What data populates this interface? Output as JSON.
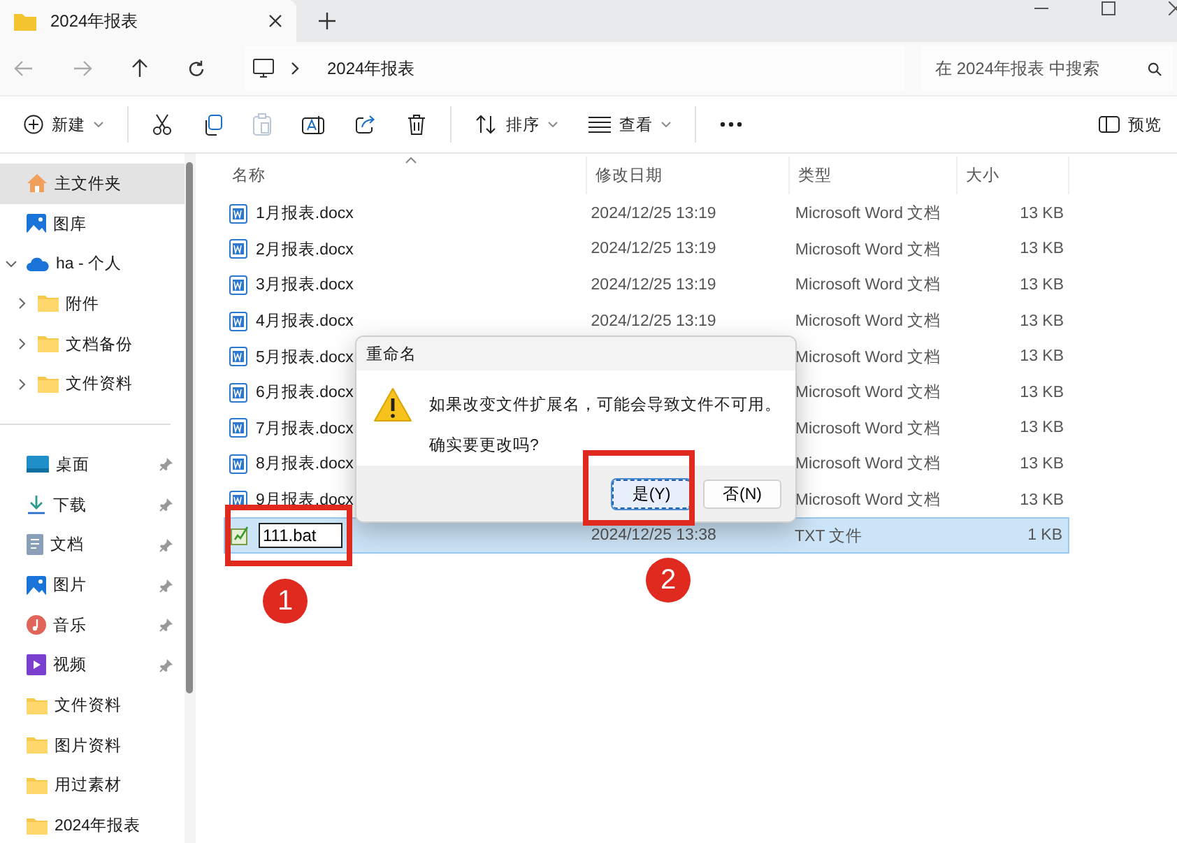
{
  "window": {
    "tab_title": "2024年报表"
  },
  "address": {
    "path": "2024年报表",
    "search_placeholder": "在 2024年报表 中搜索"
  },
  "toolbar": [
    {
      "kind": "new",
      "label": "新建",
      "disabled": false
    },
    {
      "kind": "cut",
      "disabled": false
    },
    {
      "kind": "copy",
      "disabled": false
    },
    {
      "kind": "paste",
      "disabled": true
    },
    {
      "kind": "rename",
      "disabled": false
    },
    {
      "kind": "share",
      "disabled": false
    },
    {
      "kind": "delete",
      "disabled": false
    },
    {
      "kind": "sort",
      "label": "排序",
      "disabled": false
    },
    {
      "kind": "view",
      "label": "查看",
      "disabled": false
    },
    {
      "kind": "more",
      "disabled": false
    }
  ],
  "preview": "预览",
  "sidebar": {
    "groups": [
      [
        {
          "label": "主文件夹",
          "kind": "home",
          "selected": true
        },
        {
          "label": "图库",
          "kind": "gallery",
          "selected": false
        },
        {
          "label": "ha - 个人",
          "kind": "cloud",
          "selected": false,
          "expanded": true,
          "children": [
            {
              "label": "附件",
              "kind": "folder",
              "selected": false,
              "expanded": false
            },
            {
              "label": "文档备份",
              "kind": "folder",
              "selected": false,
              "expanded": false
            },
            {
              "label": "文件资料",
              "kind": "folder",
              "selected": false,
              "expanded": false
            }
          ]
        }
      ],
      [
        {
          "label": "桌面",
          "kind": "desktop",
          "selected": false,
          "pinned": true
        },
        {
          "label": "下载",
          "kind": "download",
          "selected": false,
          "pinned": true
        },
        {
          "label": "文档",
          "kind": "document",
          "selected": false,
          "pinned": true
        },
        {
          "label": "图片",
          "kind": "gallery",
          "selected": false,
          "pinned": true
        },
        {
          "label": "音乐",
          "kind": "music",
          "selected": false,
          "pinned": true
        },
        {
          "label": "视频",
          "kind": "video",
          "selected": false,
          "pinned": true
        },
        {
          "label": "文件资料",
          "kind": "folder",
          "selected": false,
          "pinned": false
        },
        {
          "label": "图片资料",
          "kind": "folder",
          "selected": false,
          "pinned": false
        },
        {
          "label": "用过素材",
          "kind": "folder",
          "selected": false,
          "pinned": false
        },
        {
          "label": "2024年报表",
          "kind": "folder",
          "selected": false,
          "pinned": false
        }
      ]
    ]
  },
  "table": {
    "columns": [
      {
        "label": "名称",
        "sorted": true
      },
      {
        "label": "修改日期",
        "sorted": false
      },
      {
        "label": "类型",
        "sorted": false
      },
      {
        "label": "大小",
        "sorted": false
      }
    ],
    "rows": [
      {
        "kind": "word",
        "name": "1月报表.docx",
        "date": "2024/12/25 13:19",
        "type": "Microsoft Word 文档",
        "size": "13 KB",
        "selected": false,
        "editing": false
      },
      {
        "kind": "word",
        "name": "2月报表.docx",
        "date": "2024/12/25 13:19",
        "type": "Microsoft Word 文档",
        "size": "13 KB",
        "selected": false,
        "editing": false
      },
      {
        "kind": "word",
        "name": "3月报表.docx",
        "date": "2024/12/25 13:19",
        "type": "Microsoft Word 文档",
        "size": "13 KB",
        "selected": false,
        "editing": false
      },
      {
        "kind": "word",
        "name": "4月报表.docx",
        "date": "2024/12/25 13:19",
        "type": "Microsoft Word 文档",
        "size": "13 KB",
        "selected": false,
        "editing": false
      },
      {
        "kind": "word",
        "name": "5月报表.docx",
        "type": "Microsoft Word 文档",
        "size": "13 KB",
        "selected": false,
        "editing": false
      },
      {
        "kind": "word",
        "name": "6月报表.docx",
        "type": "Microsoft Word 文档",
        "size": "13 KB",
        "selected": false,
        "editing": false
      },
      {
        "kind": "word",
        "name": "7月报表.docx",
        "type": "Microsoft Word 文档",
        "size": "13 KB",
        "selected": false,
        "editing": false
      },
      {
        "kind": "word",
        "name": "8月报表.docx",
        "type": "Microsoft Word 文档",
        "size": "13 KB",
        "selected": false,
        "editing": false
      },
      {
        "kind": "word",
        "name": "9月报表.docx",
        "type": "Microsoft Word 文档",
        "size": "13 KB",
        "selected": false,
        "editing": false
      },
      {
        "kind": "txt",
        "name": "111.bat",
        "date": "2024/12/25 13:38",
        "type": "TXT 文件",
        "size": "1 KB",
        "selected": true,
        "editing": true
      }
    ]
  },
  "dialog": {
    "title": "重命名",
    "message": "如果改变文件扩展名，可能会导致文件不可用。",
    "question": "确实要更改吗?",
    "buttons": [
      {
        "label": "是(Y)",
        "focused": true
      },
      {
        "label": "否(N)",
        "focused": false
      }
    ]
  },
  "annotations": [
    {
      "label": "1"
    },
    {
      "label": "2"
    }
  ]
}
